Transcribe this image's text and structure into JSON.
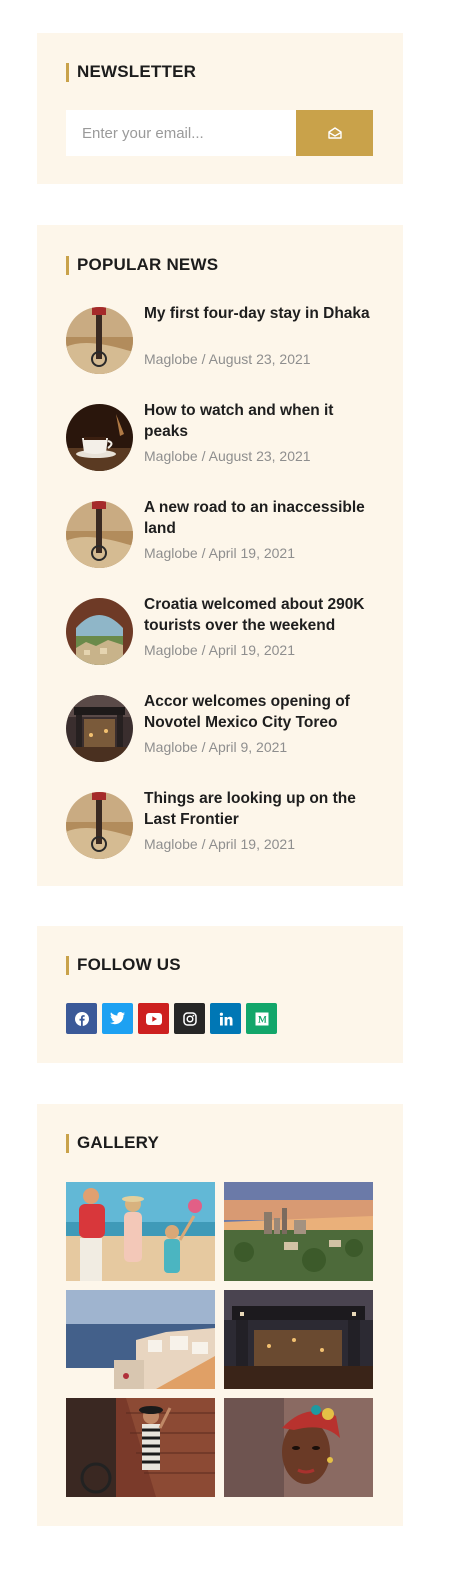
{
  "newsletter": {
    "title": "NEWSLETTER",
    "email_placeholder": "Enter your email...",
    "submit_icon": "envelope-open-icon",
    "accent_color": "#c9a24a"
  },
  "popular": {
    "title": "POPULAR NEWS",
    "items": [
      {
        "title": "My first four-day stay in Dhaka",
        "meta": "Maglobe / August 23, 2021",
        "thumb": "bicycle-field"
      },
      {
        "title": "How to watch and when it peaks",
        "meta": "Maglobe / August 23, 2021",
        "thumb": "coffee-cup"
      },
      {
        "title": "A new road to an inaccessible land",
        "meta": "Maglobe / April 19, 2021",
        "thumb": "bicycle-field"
      },
      {
        "title": "Croatia welcomed about 290K tourists over the weekend",
        "meta": "Maglobe / April 19, 2021",
        "thumb": "coastal-town-arch"
      },
      {
        "title": "Accor welcomes opening of Novotel Mexico City Toreo",
        "meta": "Maglobe / April 9, 2021",
        "thumb": "city-gate-night"
      },
      {
        "title": "Things are looking up on the Last Frontier",
        "meta": "Maglobe / April 19, 2021",
        "thumb": "bicycle-field"
      }
    ]
  },
  "follow": {
    "title": "FOLLOW US",
    "networks": [
      {
        "name": "facebook",
        "icon": "facebook-icon",
        "color": "#3b5998"
      },
      {
        "name": "twitter",
        "icon": "twitter-icon",
        "color": "#1da1f2"
      },
      {
        "name": "youtube",
        "icon": "youtube-icon",
        "color": "#cd201f"
      },
      {
        "name": "instagram",
        "icon": "instagram-icon",
        "color": "#262626"
      },
      {
        "name": "linkedin",
        "icon": "linkedin-icon",
        "color": "#0077b5"
      },
      {
        "name": "medium",
        "icon": "medium-icon",
        "color": "#12a66a"
      }
    ]
  },
  "gallery": {
    "title": "GALLERY",
    "images": [
      "family-beach",
      "city-sunset",
      "santorini-coast",
      "city-gate-night",
      "woman-brick-wall",
      "woman-portrait"
    ]
  }
}
